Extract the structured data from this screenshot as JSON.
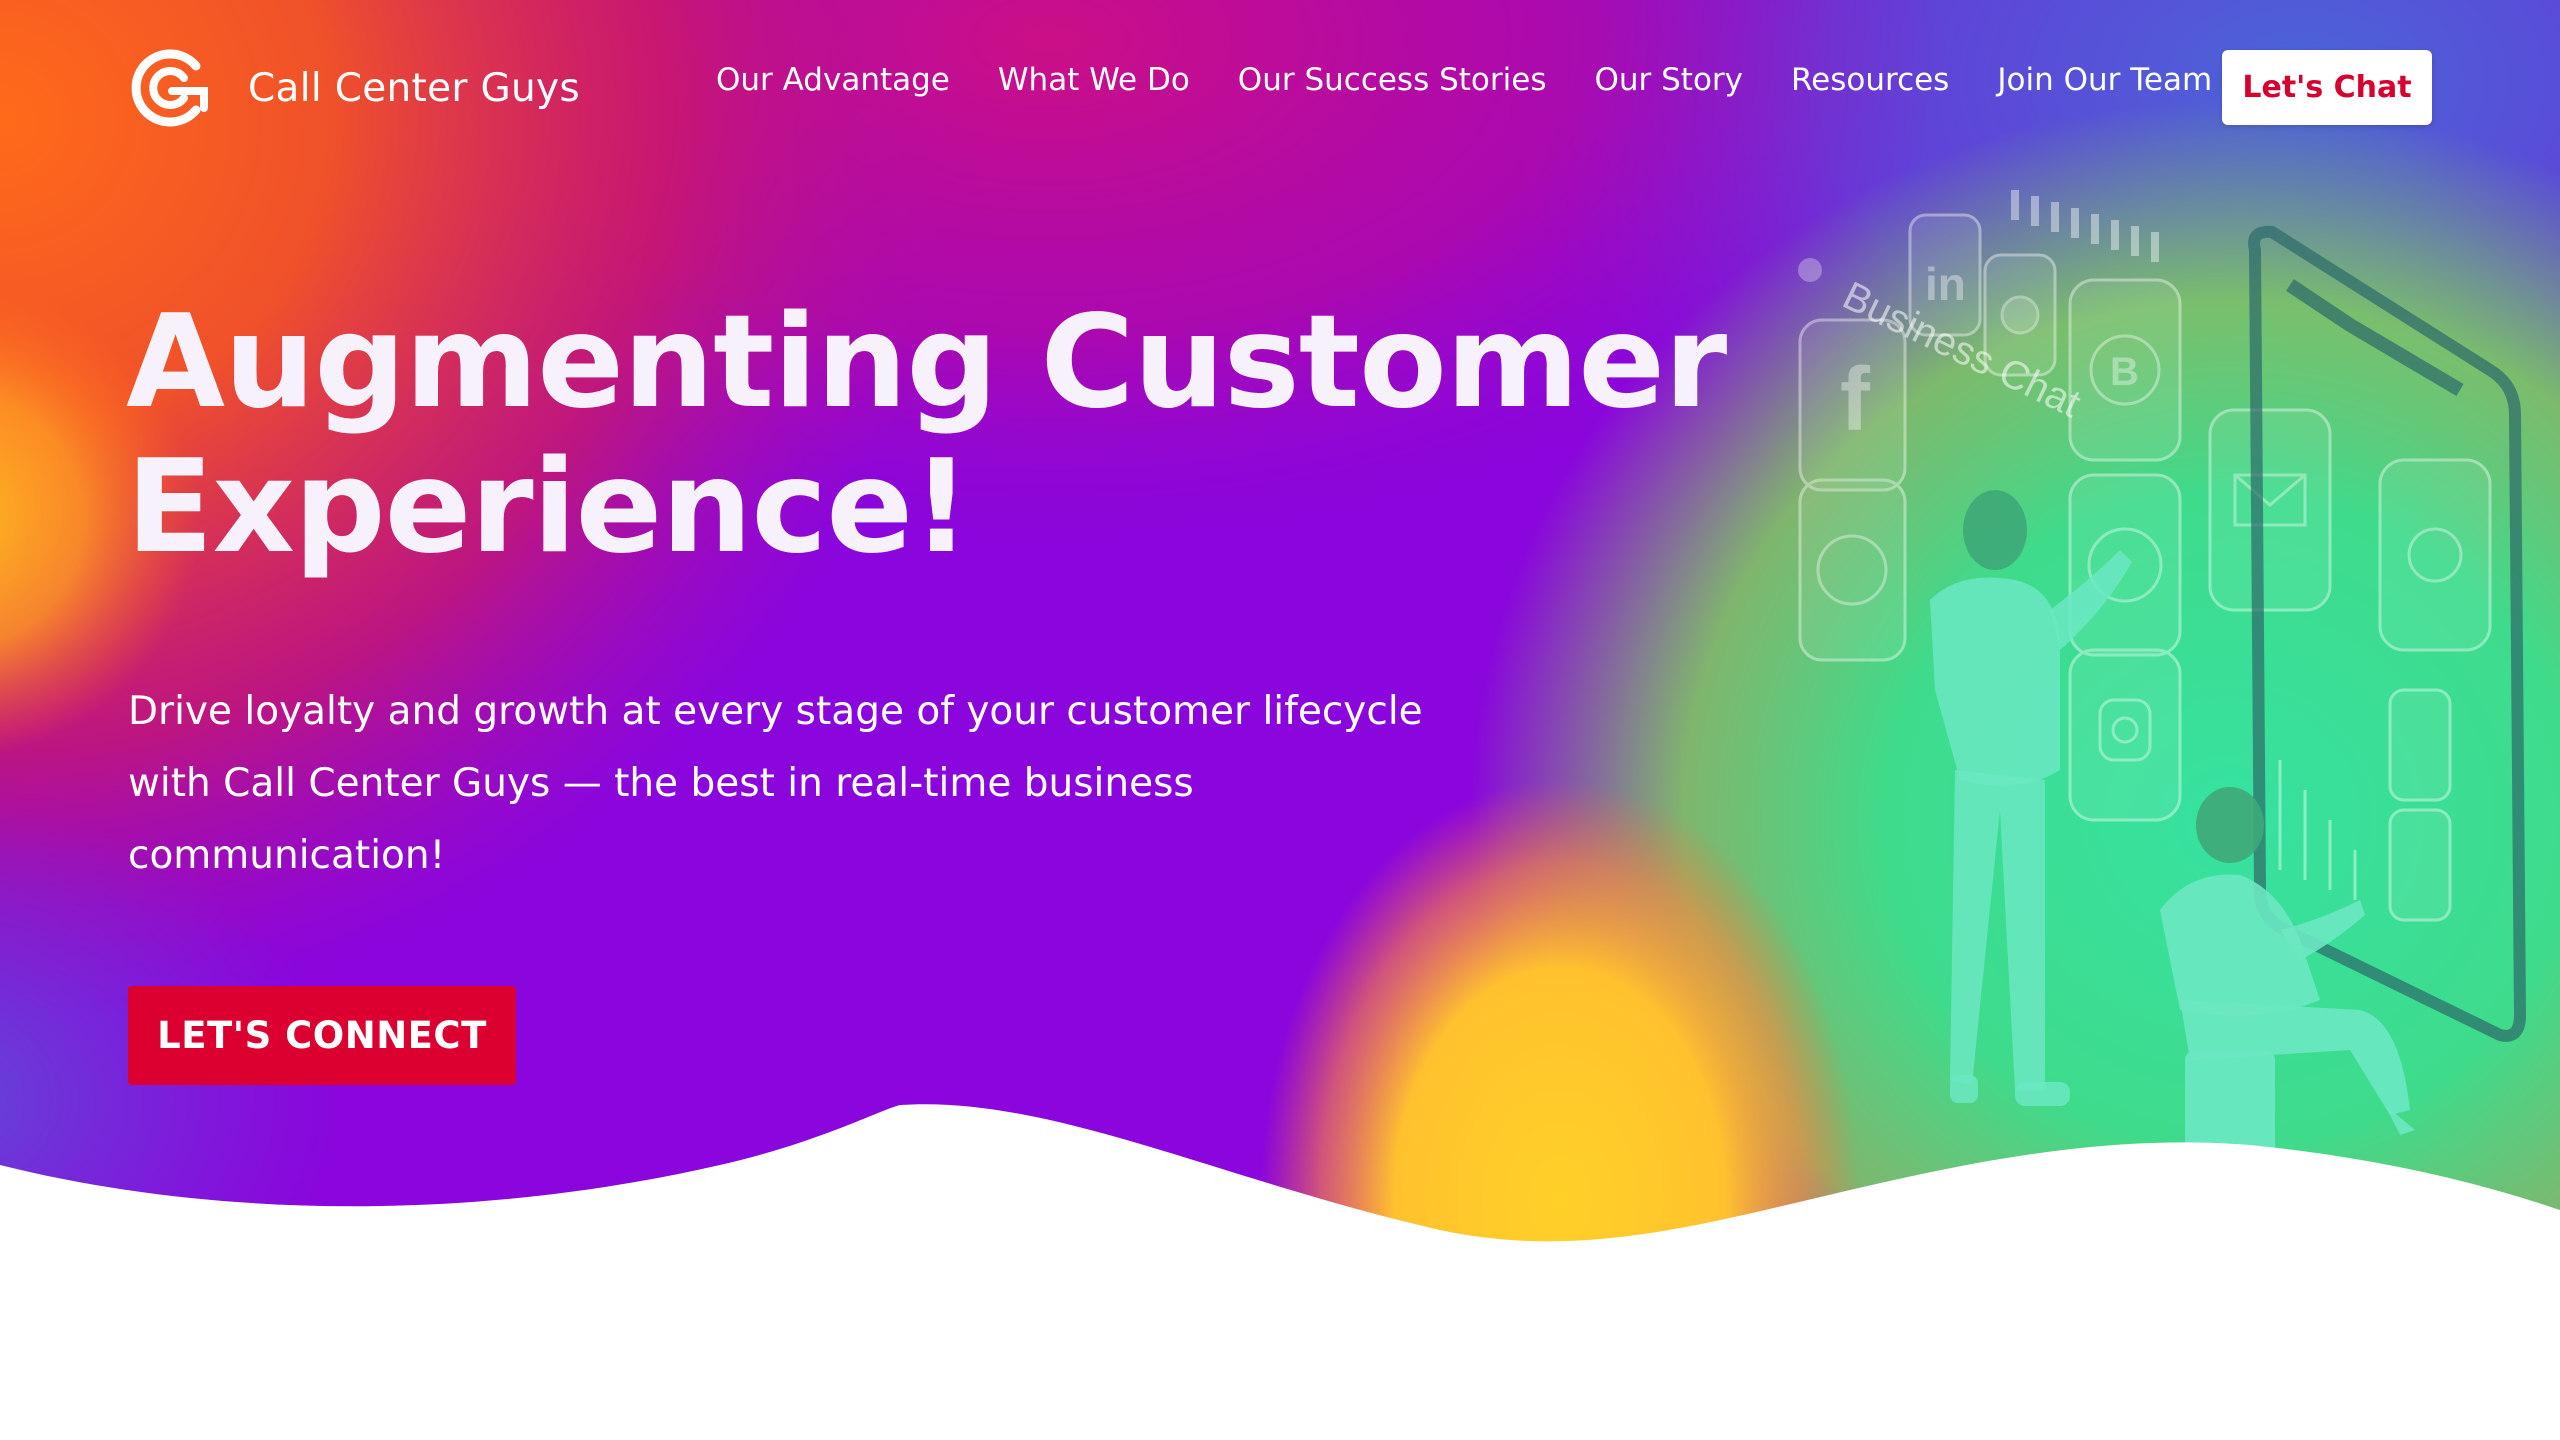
{
  "brand": {
    "name": "Call Center Guys",
    "logo_icon": "cg-logo-icon"
  },
  "nav": {
    "items": [
      {
        "label": "Our Advantage"
      },
      {
        "label": "What We Do"
      },
      {
        "label": "Our Success Stories"
      },
      {
        "label": "Our Story"
      },
      {
        "label": "Resources"
      },
      {
        "label": "Join Our Team"
      }
    ],
    "cta_label": "Let's Chat"
  },
  "hero": {
    "headline_line1": "Augmenting Customer",
    "headline_line2": "Experience!",
    "subtext": "Drive loyalty and growth at every stage of your customer lifecycle with Call Center Guys — the best in real-time business communication!",
    "cta_label": "LET'S CONNECT"
  },
  "illustration": {
    "business_chat_label": "Business Chat",
    "icons": [
      "apple-icon",
      "linkedin-icon",
      "snapchat-icon",
      "whatsapp-business-icon",
      "facebook-icon",
      "whatsapp-icon",
      "messenger-icon",
      "instagram-icon",
      "mail-icon",
      "twitter-icon",
      "phone-icon",
      "chat-icon"
    ]
  },
  "colors": {
    "accent_red": "#dc0030",
    "chat_button_text": "#d6012e",
    "purple": "#8a06dc",
    "orange": "#f26b2b",
    "yellow": "#ffcc2e",
    "green": "#3fdc8e",
    "white": "#ffffff"
  }
}
